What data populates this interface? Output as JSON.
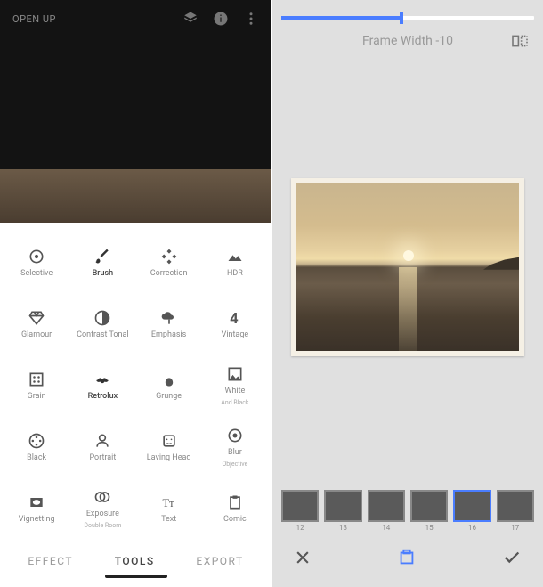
{
  "leftHeader": {
    "title": "OPEN UP"
  },
  "tools": [
    {
      "key": "selective",
      "label": "Selective"
    },
    {
      "key": "brush",
      "label": "Brush"
    },
    {
      "key": "correction",
      "label": "Correction"
    },
    {
      "key": "hdr",
      "label": "HDR"
    },
    {
      "key": "glamour",
      "label": "Glamour"
    },
    {
      "key": "contrast",
      "label": "Contrast Tonal"
    },
    {
      "key": "emphasis",
      "label": "Emphasis"
    },
    {
      "key": "vintage",
      "label": "Vintage"
    },
    {
      "key": "grain",
      "label": "Grain"
    },
    {
      "key": "retrolux",
      "label": "Retrolux"
    },
    {
      "key": "grunge",
      "label": "Grunge"
    },
    {
      "key": "white",
      "label": "White",
      "sublabel": "And Black"
    },
    {
      "key": "black",
      "label": "Black"
    },
    {
      "key": "portrait",
      "label": "Portrait"
    },
    {
      "key": "lavinghead",
      "label": "Laving Head"
    },
    {
      "key": "blur",
      "label": "Blur",
      "sublabel": "Objective"
    },
    {
      "key": "vignetting",
      "label": "Vignetting"
    },
    {
      "key": "exposure",
      "label": "Exposure",
      "sublabel": "Double Room"
    },
    {
      "key": "text",
      "label": "Text"
    },
    {
      "key": "comic",
      "label": "Comic"
    }
  ],
  "bottomTabs": {
    "effect": "EFFECT",
    "tools": "TOOLS",
    "export": "EXPORT"
  },
  "slider": {
    "label": "Frame Width",
    "value": "-10"
  },
  "frames": [
    {
      "num": "12"
    },
    {
      "num": "13"
    },
    {
      "num": "14"
    },
    {
      "num": "15"
    },
    {
      "num": "16"
    },
    {
      "num": "17"
    }
  ],
  "selectedFrame": 4
}
